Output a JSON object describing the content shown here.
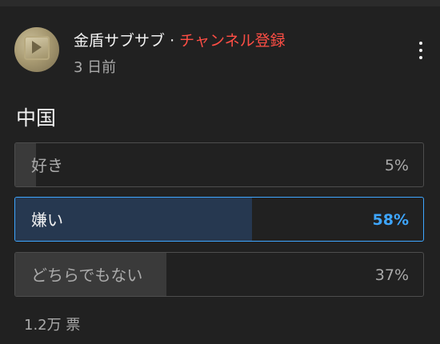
{
  "post": {
    "channel_name": "金盾サブサブ",
    "separator": "·",
    "subscribe_label": "チャンネル登録",
    "timestamp": "3 日前",
    "avatar_icon": "channel-avatar-icon",
    "more_icon": "more-vert-icon"
  },
  "poll": {
    "question": "中国",
    "options": [
      {
        "label": "好き",
        "percent_text": "5%",
        "percent": 5,
        "selected": false
      },
      {
        "label": "嫌い",
        "percent_text": "58%",
        "percent": 58,
        "selected": true
      },
      {
        "label": "どちらでもない",
        "percent_text": "37%",
        "percent": 37,
        "selected": false
      }
    ],
    "votes": "1.2万 票"
  },
  "colors": {
    "background": "#212121",
    "subscribe": "#ff4e45",
    "accent": "#3ea6ff",
    "selected_fill": "#263850",
    "fill": "#3a3a3a"
  }
}
